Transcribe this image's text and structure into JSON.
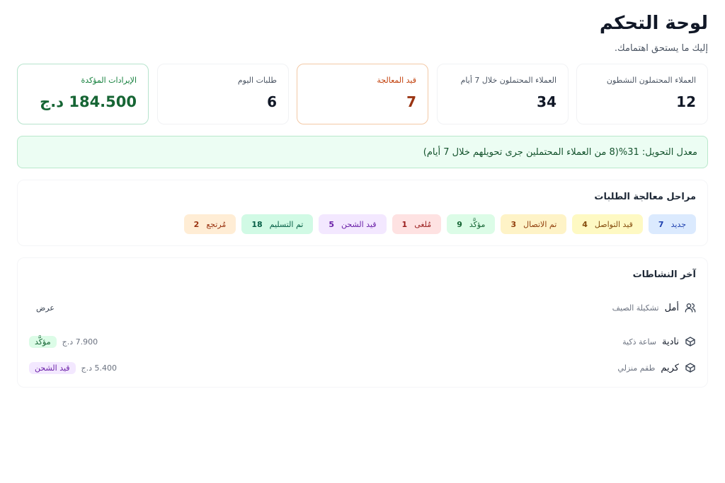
{
  "header": {
    "title": "لوحة التحكم",
    "subtitle": "إليك ما يستحق اهتمامك."
  },
  "stats": [
    {
      "label": "العملاء المحتملون النشطون",
      "value": "12"
    },
    {
      "label": "العملاء المحتملون خلال 7 أيام",
      "value": "34"
    },
    {
      "label": "قيد المعالجة",
      "value": "7"
    },
    {
      "label": "طلبات اليوم",
      "value": "6"
    },
    {
      "label": "الإيرادات المؤكدة",
      "value": "184.500 د.ج"
    }
  ],
  "conversion": {
    "text": "معدل التحويل: 31%(8 من العملاء المحتملين جرى تحويلهم خلال 7 أيام)"
  },
  "stages": {
    "title": "مراحل معالجة الطلبات",
    "items": [
      {
        "label": "جديد",
        "count": "7"
      },
      {
        "label": "قيد التواصل",
        "count": "4"
      },
      {
        "label": "تم الاتصال",
        "count": "3"
      },
      {
        "label": "مؤكَّد",
        "count": "9"
      },
      {
        "label": "مُلغى",
        "count": "1"
      },
      {
        "label": "قيد الشحن",
        "count": "5"
      },
      {
        "label": "تم التسليم",
        "count": "18"
      },
      {
        "label": "مُرتجع",
        "count": "2"
      }
    ]
  },
  "activity": {
    "title": "آخر النشاطات",
    "rows": [
      {
        "icon": "users-icon",
        "name": "أمل",
        "product": "تشكيلة الصيف",
        "action": "عرض"
      },
      {
        "icon": "box-icon",
        "name": "نادية",
        "product": "ساعة ذكية",
        "price": "7.900 د.ج",
        "status": "مؤكَّد"
      },
      {
        "icon": "box-icon",
        "name": "كريم",
        "product": "طقم منزلي",
        "price": "5.400 د.ج",
        "status": "قيد الشحن"
      }
    ]
  },
  "colors": {
    "accent_green": "#166534",
    "processing_orange": "#c2410c",
    "conversion_bg": "#ecfdf3"
  }
}
